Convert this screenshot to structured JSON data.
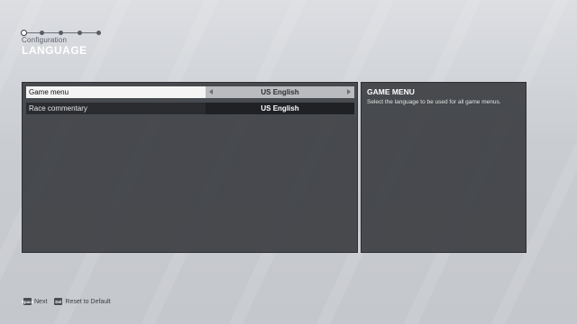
{
  "header": {
    "breadcrumb": "Configuration",
    "title": "LANGUAGE",
    "steps_total": 5,
    "steps_active_index": 0
  },
  "options": [
    {
      "label": "Game menu",
      "value": "US English",
      "selected": true
    },
    {
      "label": "Race commentary",
      "value": "US English",
      "selected": false
    }
  ],
  "description": {
    "title": "GAME MENU",
    "text": "Select the language to be used for all game menus."
  },
  "footer": {
    "next": {
      "key": "Space",
      "label": "Next"
    },
    "reset": {
      "key": "Del",
      "label": "Reset to Default"
    }
  },
  "colors": {
    "accent": "#ffffff",
    "panel": "#3c3e42",
    "background": "#c9ccd1"
  }
}
